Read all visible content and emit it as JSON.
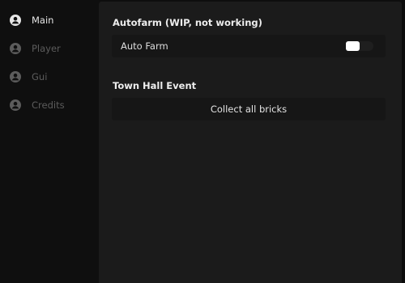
{
  "sidebar": {
    "items": [
      {
        "label": "Main",
        "icon": "user-icon",
        "active": true
      },
      {
        "label": "Player",
        "icon": "user-icon",
        "active": false
      },
      {
        "label": "Gui",
        "icon": "user-icon",
        "active": false
      },
      {
        "label": "Credits",
        "icon": "user-icon",
        "active": false
      }
    ]
  },
  "main": {
    "sections": [
      {
        "title": "Autofarm (WIP, not working)",
        "toggle": {
          "label": "Auto Farm",
          "state": "off"
        }
      },
      {
        "title": "Town Hall Event",
        "button": {
          "label": "Collect all bricks"
        }
      }
    ]
  },
  "colors": {
    "active_text": "#e6e6e6",
    "inactive_text": "#5c5c5c",
    "panel_bg": "#1b1b1b",
    "row_bg": "#161616",
    "sidebar_bg": "#0f0f0f"
  }
}
